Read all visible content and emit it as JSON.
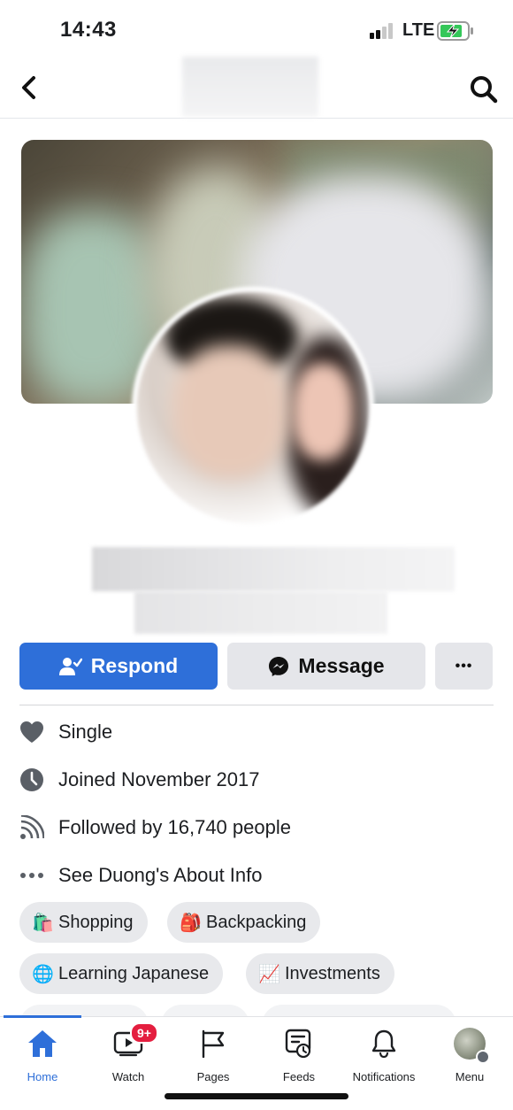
{
  "status_bar": {
    "time": "14:43",
    "network": "LTE"
  },
  "profile": {
    "actions": {
      "respond": "Respond",
      "message": "Message",
      "more": "•••"
    },
    "info": [
      {
        "icon": "heart-icon",
        "text": "Single"
      },
      {
        "icon": "clock-icon",
        "text": "Joined November 2017"
      },
      {
        "icon": "rss-icon",
        "text": "Followed by 16,740 people"
      },
      {
        "icon": "ellipsis-icon",
        "text": "See Duong's About Info"
      }
    ],
    "interests": [
      {
        "emoji": "🛍️",
        "label": "Shopping"
      },
      {
        "emoji": "🎒",
        "label": "Backpacking"
      },
      {
        "emoji": "🌐",
        "label": "Learning Japanese"
      },
      {
        "emoji": "📈",
        "label": "Investments"
      }
    ]
  },
  "tabs": [
    {
      "name": "home",
      "label": "Home",
      "active": true
    },
    {
      "name": "watch",
      "label": "Watch",
      "badge": "9+"
    },
    {
      "name": "pages",
      "label": "Pages"
    },
    {
      "name": "feeds",
      "label": "Feeds"
    },
    {
      "name": "notifications",
      "label": "Notifications"
    },
    {
      "name": "menu",
      "label": "Menu"
    }
  ],
  "colors": {
    "accent": "#2e6fd9",
    "badge": "#e41e3f",
    "chip_bg": "#e8e9ec",
    "button_gray": "#e5e6ea"
  }
}
